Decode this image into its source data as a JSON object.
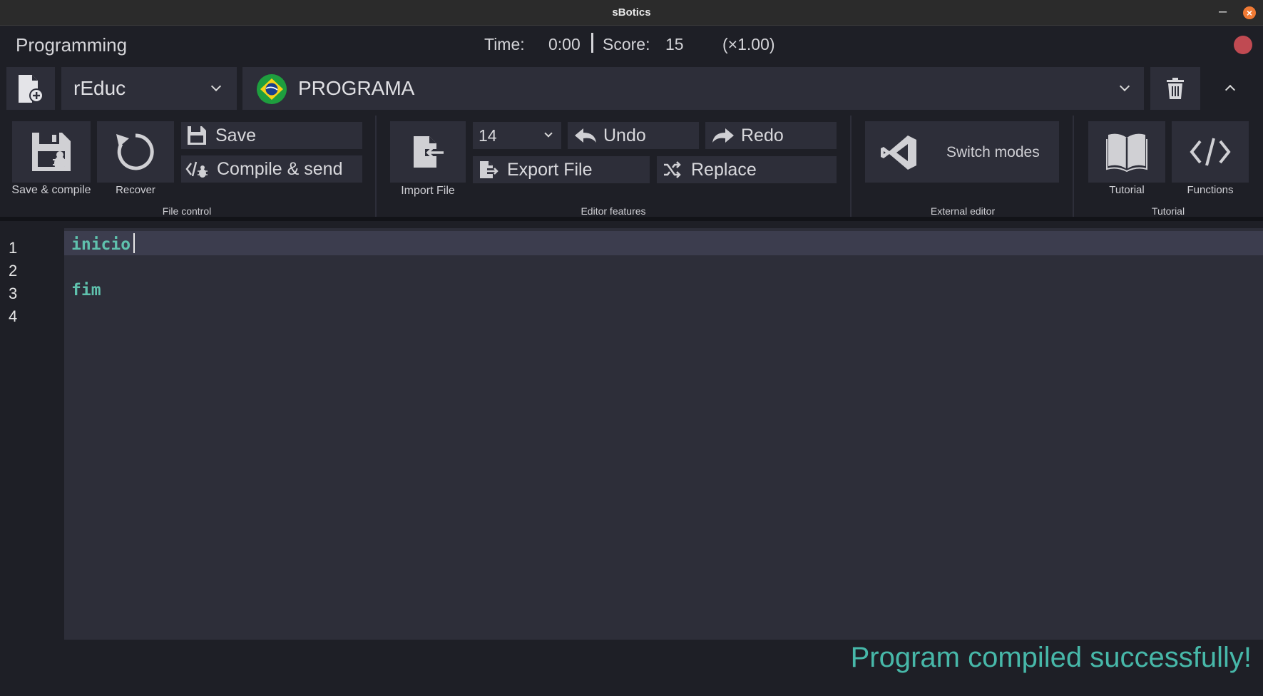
{
  "window": {
    "title": "sBotics"
  },
  "header": {
    "title": "Programming",
    "time_label": "Time:",
    "time_value": "0:00",
    "score_label": "Score:",
    "score_value": "15",
    "multiplier": "(×1.00)"
  },
  "toolbar": {
    "robot": "rEduc",
    "program": "PROGRAMA"
  },
  "ribbon": {
    "save_compile": "Save & compile",
    "recover": "Recover",
    "save": "Save",
    "compile_send": "Compile & send",
    "file_group": "File control",
    "import_file": "Import File",
    "font_size": "14",
    "undo": "Undo",
    "redo": "Redo",
    "export_file": "Export File",
    "replace": "Replace",
    "editor_group": "Editor features",
    "switch_modes": "Switch modes",
    "external_group": "External editor",
    "tutorial": "Tutorial",
    "functions": "Functions",
    "tutorial_group": "Tutorial"
  },
  "editor": {
    "line_numbers": [
      "1",
      "2",
      "3",
      "4"
    ],
    "lines": [
      "inicio",
      "",
      "fim",
      ""
    ]
  },
  "status": {
    "message": "Program compiled successfully!"
  },
  "colors": {
    "background": "#1e1f26",
    "panel": "#2d2e39",
    "accent": "#47b8a9",
    "record": "#c04a52",
    "close": "#f07a34"
  }
}
